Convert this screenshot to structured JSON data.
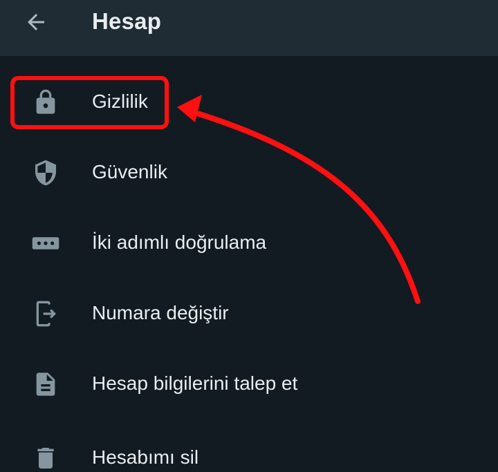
{
  "header": {
    "title": "Hesap",
    "back_icon": "arrow-left-icon"
  },
  "menu": {
    "items": [
      {
        "label": "Gizlilik",
        "icon": "lock-icon"
      },
      {
        "label": "Güvenlik",
        "icon": "shield-icon"
      },
      {
        "label": "İki adımlı doğrulama",
        "icon": "password-dots-icon"
      },
      {
        "label": "Numara değiştir",
        "icon": "change-number-icon"
      },
      {
        "label": "Hesap bilgilerini talep et",
        "icon": "document-icon"
      },
      {
        "label": "Hesabımı sil",
        "icon": "trash-icon"
      }
    ]
  },
  "annotation": {
    "highlight_color": "#ff1010",
    "arrow_color": "#ff1010",
    "highlighted_item": "Gizlilik"
  },
  "colors": {
    "background": "#121b22",
    "appbar": "#1f2c34",
    "text": "#e9edef",
    "icon": "#8696a0"
  }
}
